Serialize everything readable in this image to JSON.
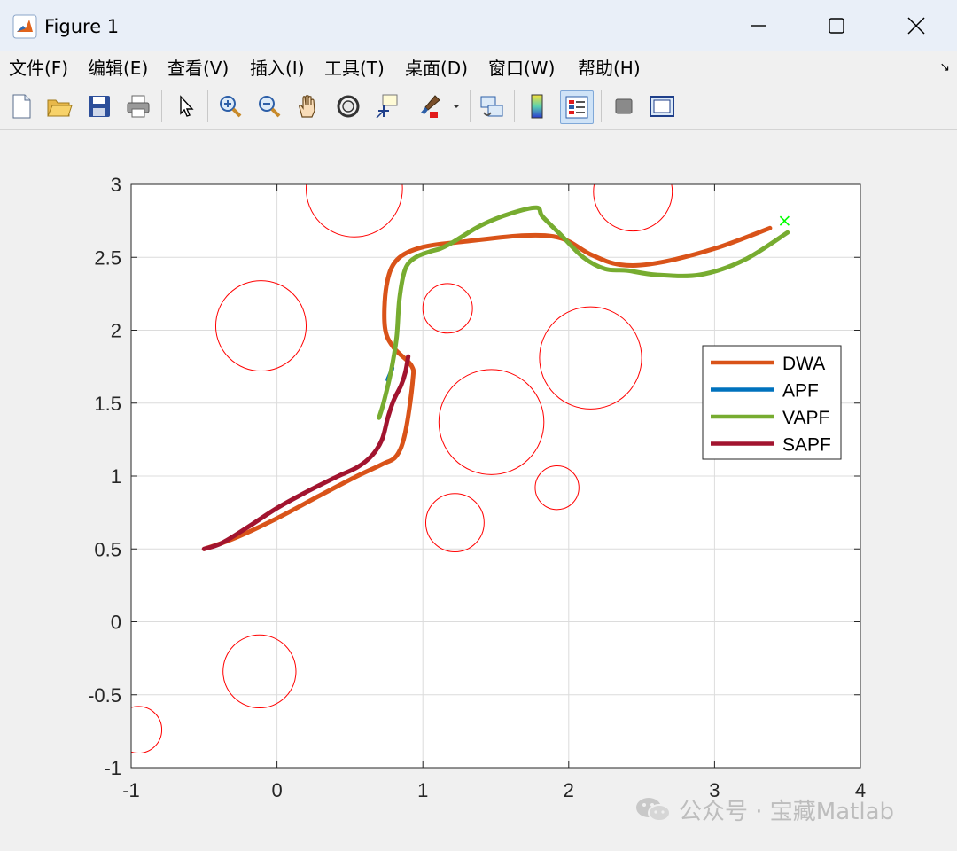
{
  "window": {
    "title": "Figure 1"
  },
  "menu": {
    "items": [
      {
        "label": "文件(F)",
        "name": "menu-file"
      },
      {
        "label": "编辑(E)",
        "name": "menu-edit"
      },
      {
        "label": "查看(V)",
        "name": "menu-view"
      },
      {
        "label": "插入(I)",
        "name": "menu-insert"
      },
      {
        "label": "工具(T)",
        "name": "menu-tools"
      },
      {
        "label": "桌面(D)",
        "name": "menu-desktop"
      },
      {
        "label": "窗口(W)",
        "name": "menu-window"
      },
      {
        "label": "帮助(H)",
        "name": "menu-help"
      }
    ]
  },
  "toolbar": {
    "icons": [
      "new-figure-icon",
      "open-file-icon",
      "save-icon",
      "print-icon",
      "pointer-icon",
      "zoom-in-icon",
      "zoom-out-icon",
      "pan-hand-icon",
      "rotate-3d-icon",
      "data-cursor-icon",
      "brush-icon",
      "link-plot-icon",
      "colorbar-icon",
      "legend-icon",
      "hide-plot-tools-icon",
      "show-plot-tools-icon"
    ]
  },
  "watermark": {
    "text": "公众号 · 宝藏Matlab",
    "icon": "wechat-icon"
  },
  "colors": {
    "DWA": "#d95319",
    "APF": "#0072bd",
    "VAPF": "#77ac30",
    "SAPF": "#a2142f",
    "obstacle": "#ff0000",
    "goal": "#00ff00"
  },
  "chart_data": {
    "type": "line",
    "xlim": [
      -1,
      4
    ],
    "ylim": [
      -1,
      3
    ],
    "xticks": [
      -1,
      0,
      1,
      2,
      3,
      4
    ],
    "yticks": [
      -1,
      -0.5,
      0,
      0.5,
      1,
      1.5,
      2,
      2.5,
      3
    ],
    "xtick_labels": [
      "-1",
      "0",
      "1",
      "2",
      "3",
      "4"
    ],
    "ytick_labels": [
      "-1",
      "-0.5",
      "0",
      "0.5",
      "1",
      "1.5",
      "2",
      "2.5",
      "3"
    ],
    "grid": true,
    "legend_position": "right",
    "obstacles": [
      {
        "cx": 0.53,
        "cy": 2.97,
        "r": 0.33
      },
      {
        "cx": -0.11,
        "cy": 2.03,
        "r": 0.31
      },
      {
        "cx": 1.17,
        "cy": 2.15,
        "r": 0.17
      },
      {
        "cx": 2.15,
        "cy": 1.81,
        "r": 0.35
      },
      {
        "cx": 1.47,
        "cy": 1.37,
        "r": 0.36
      },
      {
        "cx": 1.92,
        "cy": 0.92,
        "r": 0.15
      },
      {
        "cx": 1.22,
        "cy": 0.68,
        "r": 0.2
      },
      {
        "cx": -0.12,
        "cy": -0.34,
        "r": 0.25
      },
      {
        "cx": -0.95,
        "cy": -0.74,
        "r": 0.16
      },
      {
        "cx": 2.44,
        "cy": 2.95,
        "r": 0.27
      }
    ],
    "goal": {
      "x": 3.48,
      "y": 2.75
    },
    "series": [
      {
        "name": "DWA",
        "color": "#d95319",
        "x": [
          -0.5,
          -0.3,
          0,
          0.3,
          0.55,
          0.72,
          0.82,
          0.88,
          0.93,
          0.92,
          0.8,
          0.74,
          0.75,
          0.82,
          1.0,
          1.3,
          1.7,
          1.95,
          2.15,
          2.35,
          2.6,
          3.0,
          3.38
        ],
        "y": [
          0.5,
          0.57,
          0.71,
          0.87,
          1.0,
          1.08,
          1.14,
          1.3,
          1.65,
          1.76,
          1.88,
          2.02,
          2.3,
          2.48,
          2.57,
          2.61,
          2.65,
          2.63,
          2.52,
          2.45,
          2.46,
          2.56,
          2.7
        ]
      },
      {
        "name": "APF",
        "color": "#0072bd",
        "x": [
          0.76,
          0.78,
          0.79
        ],
        "y": [
          1.66,
          1.71,
          1.74
        ]
      },
      {
        "name": "VAPF",
        "color": "#77ac30",
        "x": [
          0.7,
          0.73,
          0.78,
          0.82,
          0.84,
          0.88,
          0.95,
          1.05,
          1.12,
          1.2,
          1.4,
          1.6,
          1.78,
          1.82,
          1.95,
          2.1,
          2.25,
          2.4,
          2.6,
          2.9,
          3.2,
          3.5
        ],
        "y": [
          1.4,
          1.5,
          1.71,
          1.95,
          2.22,
          2.42,
          2.5,
          2.54,
          2.56,
          2.6,
          2.72,
          2.8,
          2.84,
          2.78,
          2.65,
          2.5,
          2.42,
          2.41,
          2.38,
          2.38,
          2.48,
          2.67
        ]
      },
      {
        "name": "SAPF",
        "color": "#a2142f",
        "x": [
          -0.5,
          -0.38,
          -0.2,
          0,
          0.2,
          0.4,
          0.55,
          0.65,
          0.72,
          0.76,
          0.8,
          0.85,
          0.88,
          0.9
        ],
        "y": [
          0.5,
          0.54,
          0.65,
          0.78,
          0.89,
          0.99,
          1.06,
          1.14,
          1.25,
          1.4,
          1.52,
          1.62,
          1.71,
          1.82
        ]
      }
    ]
  }
}
